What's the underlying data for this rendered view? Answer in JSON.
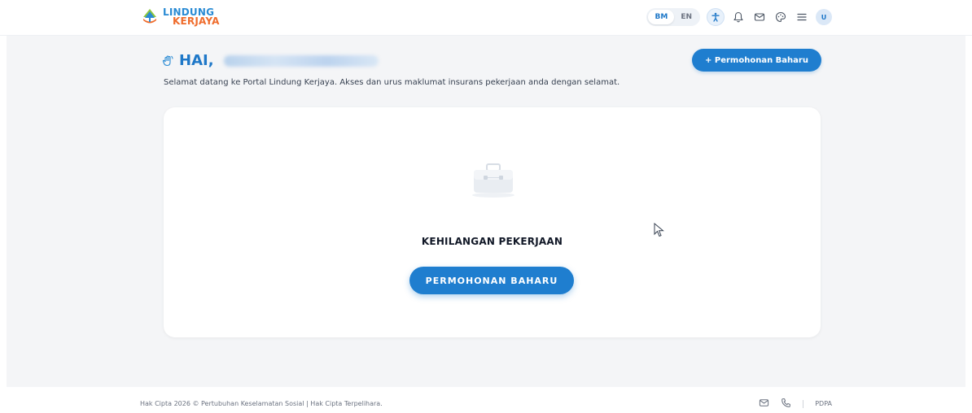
{
  "header": {
    "logo_line1": "LINDUNG",
    "logo_line2": "KERJAYA",
    "lang_bm": "BM",
    "lang_en": "EN",
    "active_lang": "BM",
    "avatar_initial": "U",
    "icons": [
      "accessibility-icon",
      "bell-icon",
      "mail-icon",
      "palette-icon",
      "menu-icon"
    ]
  },
  "greeting": {
    "label": "HAI,",
    "icon": "wave-hand-icon",
    "subtitle": "Selamat datang ke Portal Lindung Kerjaya. Akses dan urus maklumat insurans pekerjaan anda dengan selamat."
  },
  "actions": {
    "new_application": "+ Permohonan Baharu"
  },
  "card": {
    "title": "KEHILANGAN PEKERJAAN",
    "button": "PERMOHONAN BAHARU",
    "illustration": "briefcase-icon"
  },
  "footer": {
    "copyright": "Hak Cipta 2026 © Pertubuhan Keselamatan Sosial | Hak Cipta Terpelihara.",
    "pdpa": "PDPA",
    "icons": [
      "mail-icon",
      "phone-icon"
    ]
  },
  "colors": {
    "primary": "#1f7ecf",
    "logo_blue": "#2a8bd4",
    "logo_orange": "#ef6c2c",
    "background": "#f4f5f7"
  }
}
